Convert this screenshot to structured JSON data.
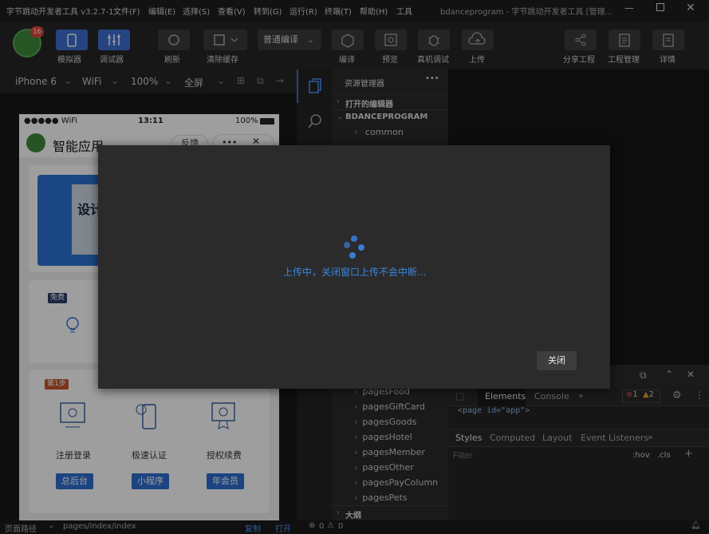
{
  "titlebar": {
    "app_title": "字节跳动开发者工具 v3.2.7-1",
    "menu": [
      "文件(F)",
      "编辑(E)",
      "选择(S)",
      "查看(V)",
      "转到(G)",
      "运行(R)",
      "终端(T)",
      "帮助(H)",
      "工具"
    ],
    "window_title": "bdanceprogram - 字节跳动开发者工具 [管理..."
  },
  "toolbar": {
    "avatar_badge": "16",
    "simulator": "模拟器",
    "debugger": "调试器",
    "refresh": "刷新",
    "clear_cache": "清除缓存",
    "compile_mode": "普通编译",
    "compile": "编译",
    "preview": "预览",
    "real_debug": "真机调试",
    "upload": "上传",
    "share": "分享工程",
    "manage": "工程管理",
    "details": "详情"
  },
  "subbar": {
    "device": "iPhone 6",
    "network": "WiFi",
    "zoom": "100%",
    "fullscreen": "全屏"
  },
  "phone": {
    "signal": "●●●●● WiFi",
    "time": "13:11",
    "battery": "100%",
    "app_name": "智能应用",
    "feedback": "反馈",
    "more": "•••",
    "close": "✕",
    "banner_text": "设计",
    "free_tag": "免费",
    "step_tag": "第1步",
    "cards": [
      {
        "label": "注册登录",
        "button": "总后台"
      },
      {
        "label": "极速认证",
        "button": "小程序"
      },
      {
        "label": "授权续费",
        "button": "年会员"
      }
    ]
  },
  "explorer": {
    "header": "资源管理器",
    "more": "•••",
    "open_editors": "打开的编辑器",
    "project": "BDANCEPROGRAM",
    "folders_top": [
      "common"
    ],
    "folders_bottom": [
      "pagesFood",
      "pagesGiftCard",
      "pagesGoods",
      "pagesHotel",
      "pagesMember",
      "pagesOther",
      "pagesPayColumn",
      "pagesPets"
    ],
    "outline": "大纲"
  },
  "devtools": {
    "tabs": [
      "Elements",
      "Console"
    ],
    "errors": "1",
    "warnings": "2",
    "dom_line": "<page id=\"app\">",
    "style_tabs": [
      "Styles",
      "Computed",
      "Layout",
      "Event Listeners"
    ],
    "filter_placeholder": "Filter",
    "hov": ":hov",
    "cls": ".cls"
  },
  "modal": {
    "message": "上传中，关闭窗口上传不会中断...",
    "close_label": "关闭"
  },
  "statusbar": {
    "path_label": "页面路径",
    "path": "pages/index/index",
    "copy": "复制",
    "open": "打开",
    "errors": "0",
    "warnings": "0"
  },
  "colors": {
    "accent": "#3c6fd0",
    "spinner": "#3a7cd6",
    "modal_text": "#3a86e0"
  }
}
